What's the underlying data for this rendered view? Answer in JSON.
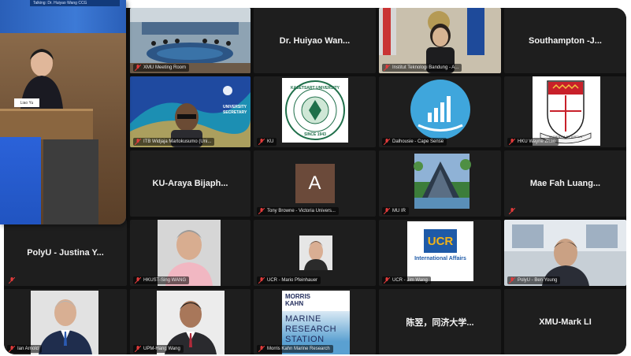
{
  "speaker": {
    "header_text": "Talking: Dr. Huiyao Wang CCG",
    "nameplate": "Liao Yu"
  },
  "tiles": [
    {
      "id": "t1",
      "caption": "XMU Meeting Room",
      "type": "room"
    },
    {
      "id": "t2",
      "display_name": "Dr. Huiyao Wan...",
      "type": "name"
    },
    {
      "id": "t3",
      "caption": "Institut Teknologi Bandung - A...",
      "type": "woman"
    },
    {
      "id": "t4",
      "display_name": "Southampton -J...",
      "type": "name"
    },
    {
      "id": "t5",
      "caption": "ITB Widjaja Martokusumo (Uni...",
      "type": "itb",
      "screen_text": [
        "UNIVERSITY",
        "SECRETARY"
      ]
    },
    {
      "id": "t6",
      "caption": "KU",
      "type": "seal",
      "seal_top": "KASETSART UNIVERSITY",
      "seal_bottom": "SINCE 1943"
    },
    {
      "id": "t7",
      "caption": "Dalhousie - Cape Sense",
      "type": "barlogo"
    },
    {
      "id": "t8",
      "caption": "HKU Wayne Zhao",
      "type": "hku",
      "motto": "SAPIENTIA ET VIRTUS"
    },
    {
      "id": "t9",
      "display_name": "KU-Araya Bijaph...",
      "type": "name"
    },
    {
      "id": "t10",
      "caption": "Tony Browne - Victoria Univers...",
      "type": "avatar",
      "avatar_letter": "A"
    },
    {
      "id": "t11",
      "caption": "MU IR",
      "type": "building"
    },
    {
      "id": "t12",
      "display_name": "Mae Fah Luang...",
      "type": "name"
    },
    {
      "id": "t13",
      "display_name": "PolyU - Justina Y...",
      "type": "name",
      "caption": ""
    },
    {
      "id": "t14",
      "caption": "HKUST-Sing WANG",
      "type": "man1"
    },
    {
      "id": "t15",
      "caption": "UCR - Mario Pfeinhauer",
      "type": "man2"
    },
    {
      "id": "t16",
      "caption": "UCR - Jim Wang",
      "type": "ucr",
      "logo": "UCR",
      "sub": "International Affairs"
    },
    {
      "id": "t17",
      "caption": "PolyU - Ben Young",
      "type": "office"
    },
    {
      "id": "t18",
      "caption": "Ian Arnold",
      "type": "man3"
    },
    {
      "id": "t19",
      "caption": "UPM-Hang Wang",
      "type": "man4"
    },
    {
      "id": "t20",
      "caption": "Morris Kahn Marine Research",
      "type": "mkmrs",
      "line1": "MORRIS",
      "line2": "KAHN",
      "line3": "MARINE",
      "line4": "RESEARCH",
      "line5": "STATION"
    },
    {
      "id": "t21",
      "display_name": "陈翌，同济大学...",
      "type": "name"
    },
    {
      "id": "t22",
      "display_name": "XMU-Mark LI",
      "type": "name"
    }
  ],
  "colors": {
    "grid_bg": "#101010",
    "tile_bg": "#202020",
    "mic_muted": "#e23b3b",
    "ucr_blue": "#1e5aa8",
    "ucr_gold": "#f2b418"
  }
}
